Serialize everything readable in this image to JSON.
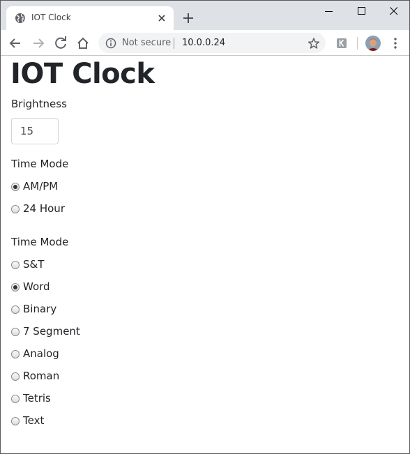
{
  "browser": {
    "tab_title": "IOT Clock",
    "security_label": "Not secure",
    "url": "10.0.0.24"
  },
  "page": {
    "title": "IOT Clock",
    "brightness": {
      "label": "Brightness",
      "value": "15"
    },
    "time_mode": {
      "label": "Time Mode",
      "options": [
        {
          "label": "AM/PM",
          "checked": true
        },
        {
          "label": "24 Hour",
          "checked": false
        }
      ]
    },
    "display_mode": {
      "label": "Time Mode",
      "options": [
        {
          "label": "S&T",
          "checked": false
        },
        {
          "label": "Word",
          "checked": true
        },
        {
          "label": "Binary",
          "checked": false
        },
        {
          "label": "7 Segment",
          "checked": false
        },
        {
          "label": "Analog",
          "checked": false
        },
        {
          "label": "Roman",
          "checked": false
        },
        {
          "label": "Tetris",
          "checked": false
        },
        {
          "label": "Text",
          "checked": false
        }
      ]
    }
  }
}
